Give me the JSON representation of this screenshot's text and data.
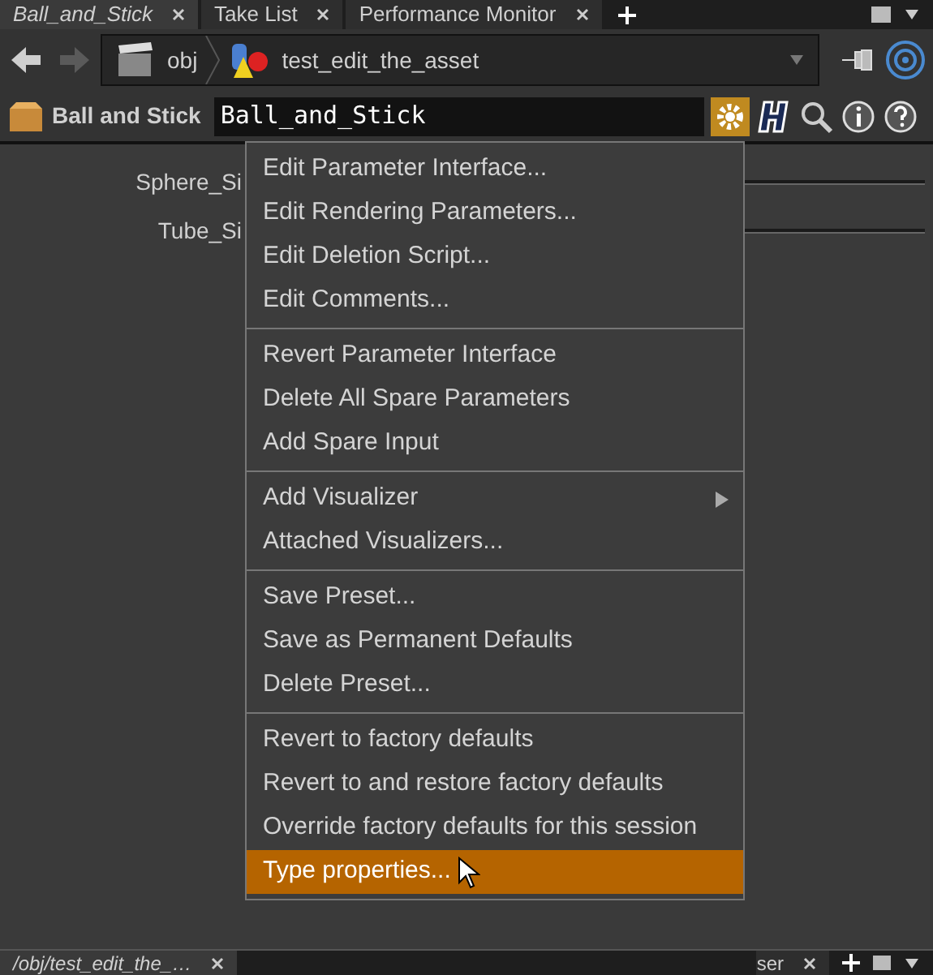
{
  "tabs": [
    {
      "label": "Ball_and_Stick",
      "selected": true
    },
    {
      "label": "Take List",
      "selected": false
    },
    {
      "label": "Performance Monitor",
      "selected": false
    }
  ],
  "path": {
    "segments": [
      "obj",
      "test_edit_the_asset"
    ]
  },
  "node": {
    "type_label": "Ball and Stick",
    "name": "Ball_and_Stick"
  },
  "parameters": [
    {
      "label": "Sphere_Si"
    },
    {
      "label": "Tube_Si"
    }
  ],
  "menu": {
    "sections": [
      [
        {
          "label": "Edit Parameter Interface...",
          "kind": "item",
          "selected": false
        },
        {
          "label": "Edit Rendering Parameters...",
          "kind": "item",
          "selected": false
        },
        {
          "label": "Edit Deletion Script...",
          "kind": "item",
          "selected": false
        },
        {
          "label": "Edit Comments...",
          "kind": "item",
          "selected": false
        }
      ],
      [
        {
          "label": "Revert Parameter Interface",
          "kind": "item",
          "selected": false
        },
        {
          "label": "Delete All Spare Parameters",
          "kind": "item",
          "selected": false
        },
        {
          "label": "Add Spare Input",
          "kind": "item",
          "selected": false
        }
      ],
      [
        {
          "label": "Add Visualizer",
          "kind": "submenu",
          "selected": false
        },
        {
          "label": "Attached Visualizers...",
          "kind": "item",
          "selected": false
        }
      ],
      [
        {
          "label": "Save Preset...",
          "kind": "item",
          "selected": false
        },
        {
          "label": "Save as Permanent Defaults",
          "kind": "item",
          "selected": false
        },
        {
          "label": "Delete Preset...",
          "kind": "item",
          "selected": false
        }
      ],
      [
        {
          "label": "Revert to factory defaults",
          "kind": "item",
          "selected": false
        },
        {
          "label": "Revert to and restore factory defaults",
          "kind": "item",
          "selected": false
        },
        {
          "label": "Override factory defaults for this session",
          "kind": "item",
          "selected": false
        },
        {
          "label": "Type properties...",
          "kind": "item",
          "selected": true
        }
      ]
    ]
  },
  "bottom_tabs": [
    {
      "label": "/obj/test_edit_the_…",
      "selected": true
    },
    {
      "label": "ser",
      "selected": false
    }
  ]
}
